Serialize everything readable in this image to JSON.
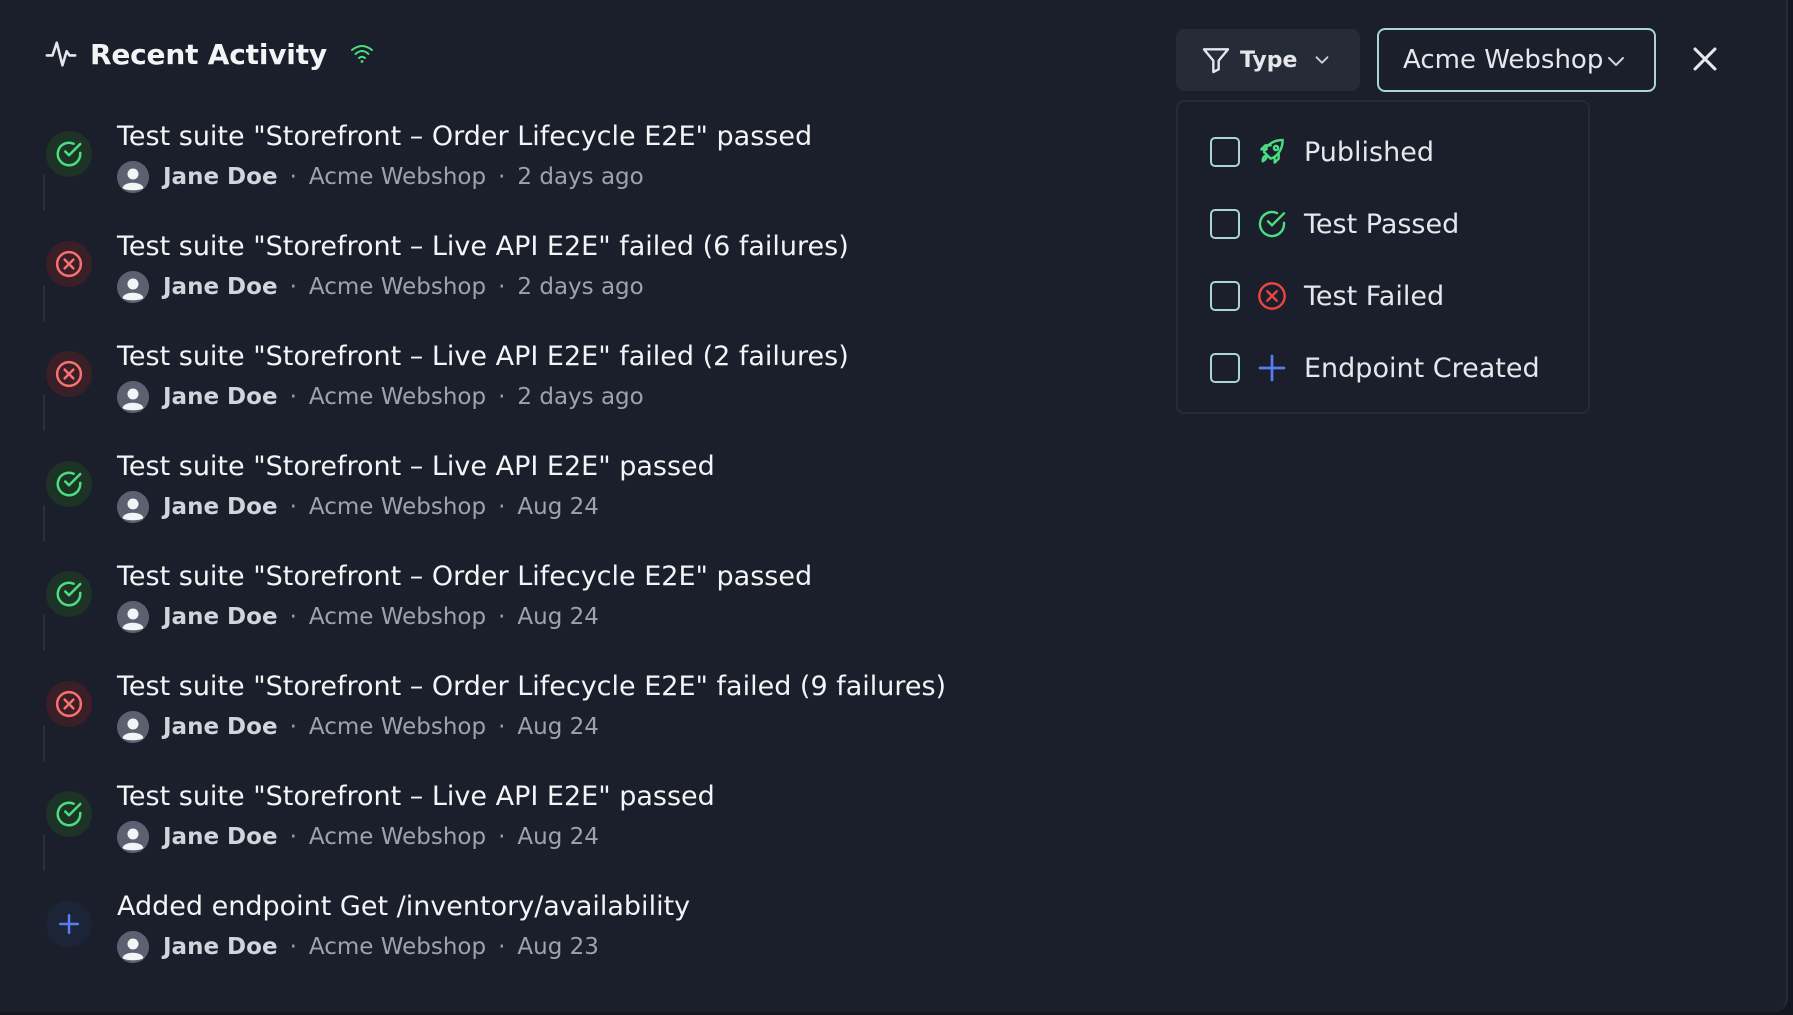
{
  "header": {
    "title": "Recent Activity"
  },
  "toolbar": {
    "type_filter_label": "Type",
    "project_select_value": "Acme Webshop"
  },
  "type_dropdown": {
    "options": [
      {
        "label": "Published",
        "checked": false,
        "icon": "rocket-icon",
        "color": "#4ade80"
      },
      {
        "label": "Test Passed",
        "checked": false,
        "icon": "check-circle-icon",
        "color": "#4ade80"
      },
      {
        "label": "Test Failed",
        "checked": false,
        "icon": "x-circle-icon",
        "color": "#f87171"
      },
      {
        "label": "Endpoint Created",
        "checked": false,
        "icon": "plus-icon",
        "color": "#5b7cf5"
      }
    ]
  },
  "activities": [
    {
      "title": "Test suite \"Storefront – Order Lifecycle E2E\" passed",
      "status": "passed",
      "user": "Jane Doe",
      "project": "Acme Webshop",
      "time": "2 days ago"
    },
    {
      "title": "Test suite \"Storefront – Live API E2E\" failed (6 failures)",
      "status": "failed",
      "user": "Jane Doe",
      "project": "Acme Webshop",
      "time": "2 days ago"
    },
    {
      "title": "Test suite \"Storefront – Live API E2E\" failed (2 failures)",
      "status": "failed",
      "user": "Jane Doe",
      "project": "Acme Webshop",
      "time": "2 days ago"
    },
    {
      "title": "Test suite \"Storefront – Live API E2E\" passed",
      "status": "passed",
      "user": "Jane Doe",
      "project": "Acme Webshop",
      "time": "Aug 24"
    },
    {
      "title": "Test suite \"Storefront – Order Lifecycle E2E\" passed",
      "status": "passed",
      "user": "Jane Doe",
      "project": "Acme Webshop",
      "time": "Aug 24"
    },
    {
      "title": "Test suite \"Storefront – Order Lifecycle E2E\" failed (9 failures)",
      "status": "failed",
      "user": "Jane Doe",
      "project": "Acme Webshop",
      "time": "Aug 24"
    },
    {
      "title": "Test suite \"Storefront – Live API E2E\" passed",
      "status": "passed",
      "user": "Jane Doe",
      "project": "Acme Webshop",
      "time": "Aug 24"
    },
    {
      "title": "Added endpoint Get /inventory/availability",
      "status": "created",
      "user": "Jane Doe",
      "project": "Acme Webshop",
      "time": "Aug 23"
    }
  ],
  "colors": {
    "passed": "#4ade80",
    "failed": "#f87171",
    "created": "#5b7cf5",
    "accent_border": "#a7d7cf"
  }
}
